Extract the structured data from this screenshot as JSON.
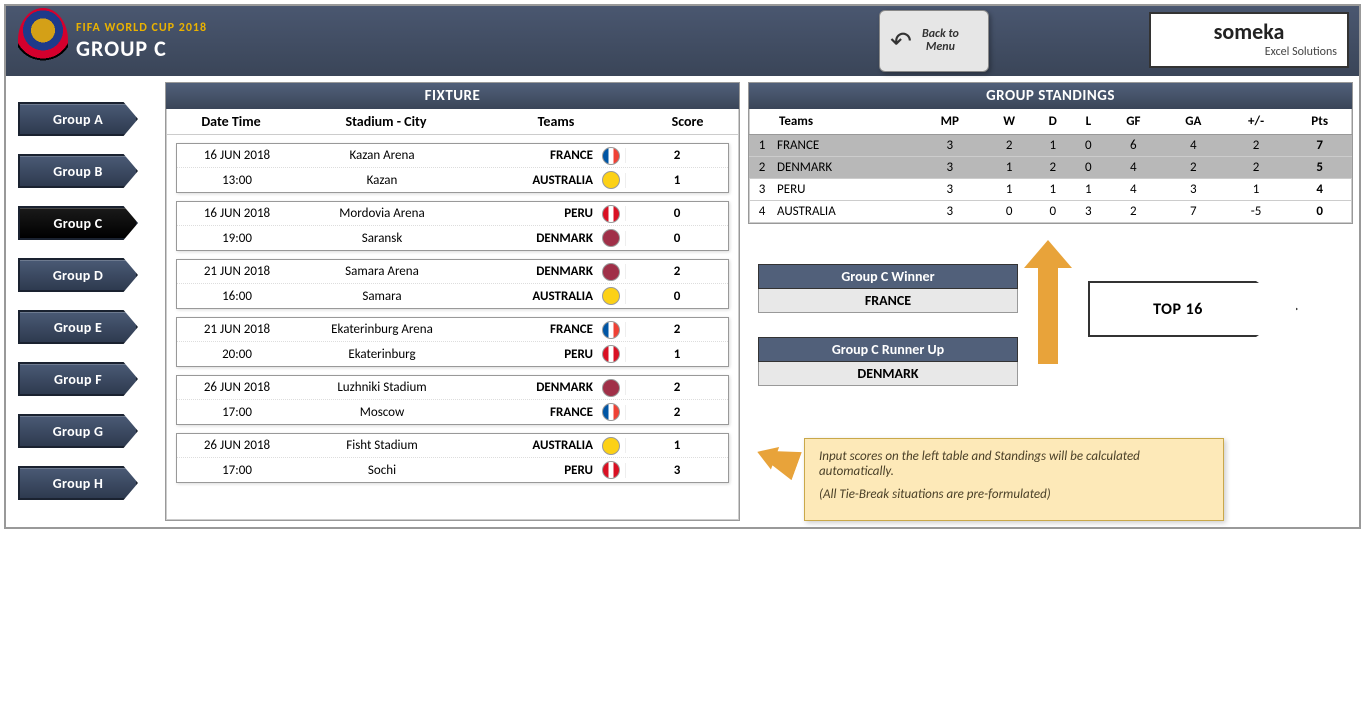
{
  "header": {
    "subtitle": "FIFA WORLD CUP 2018",
    "title": "GROUP C",
    "back_line1": "Back to",
    "back_line2": "Menu",
    "brand": "someka",
    "brand_sub": "Excel Solutions"
  },
  "nav": [
    {
      "label": "Group A",
      "active": false
    },
    {
      "label": "Group B",
      "active": false
    },
    {
      "label": "Group C",
      "active": true
    },
    {
      "label": "Group D",
      "active": false
    },
    {
      "label": "Group E",
      "active": false
    },
    {
      "label": "Group F",
      "active": false
    },
    {
      "label": "Group G",
      "active": false
    },
    {
      "label": "Group H",
      "active": false
    }
  ],
  "fixture": {
    "title": "FIXTURE",
    "cols": {
      "date": "Date Time",
      "stadium": "Stadium - City",
      "teams": "Teams",
      "score": "Score"
    },
    "matches": [
      {
        "date": "16 JUN 2018",
        "time": "13:00",
        "stadium": "Kazan Arena",
        "city": "Kazan",
        "team1": "FRANCE",
        "flag1": "france",
        "score1": "2",
        "team2": "AUSTRALIA",
        "flag2": "australia",
        "score2": "1"
      },
      {
        "date": "16 JUN 2018",
        "time": "19:00",
        "stadium": "Mordovia Arena",
        "city": "Saransk",
        "team1": "PERU",
        "flag1": "peru",
        "score1": "0",
        "team2": "DENMARK",
        "flag2": "denmark",
        "score2": "0"
      },
      {
        "date": "21 JUN 2018",
        "time": "16:00",
        "stadium": "Samara Arena",
        "city": "Samara",
        "team1": "DENMARK",
        "flag1": "denmark",
        "score1": "2",
        "team2": "AUSTRALIA",
        "flag2": "australia",
        "score2": "0"
      },
      {
        "date": "21 JUN 2018",
        "time": "20:00",
        "stadium": "Ekaterinburg Arena",
        "city": "Ekaterinburg",
        "team1": "FRANCE",
        "flag1": "france",
        "score1": "2",
        "team2": "PERU",
        "flag2": "peru",
        "score2": "1"
      },
      {
        "date": "26 JUN 2018",
        "time": "17:00",
        "stadium": "Luzhniki Stadium",
        "city": "Moscow",
        "team1": "DENMARK",
        "flag1": "denmark",
        "score1": "2",
        "team2": "FRANCE",
        "flag2": "france",
        "score2": "2"
      },
      {
        "date": "26 JUN 2018",
        "time": "17:00",
        "stadium": "Fisht Stadium",
        "city": "Sochi",
        "team1": "AUSTRALIA",
        "flag1": "australia",
        "score1": "1",
        "team2": "PERU",
        "flag2": "peru",
        "score2": "3"
      }
    ]
  },
  "standings": {
    "title": "GROUP STANDINGS",
    "cols": {
      "teams": "Teams",
      "mp": "MP",
      "w": "W",
      "d": "D",
      "l": "L",
      "gf": "GF",
      "ga": "GA",
      "diff": "+/-",
      "pts": "Pts"
    },
    "rows": [
      {
        "rank": "1",
        "team": "FRANCE",
        "mp": "3",
        "w": "2",
        "d": "1",
        "l": "0",
        "gf": "6",
        "ga": "4",
        "diff": "2",
        "pts": "7",
        "q": true
      },
      {
        "rank": "2",
        "team": "DENMARK",
        "mp": "3",
        "w": "1",
        "d": "2",
        "l": "0",
        "gf": "4",
        "ga": "2",
        "diff": "2",
        "pts": "5",
        "q": true
      },
      {
        "rank": "3",
        "team": "PERU",
        "mp": "3",
        "w": "1",
        "d": "1",
        "l": "1",
        "gf": "4",
        "ga": "3",
        "diff": "1",
        "pts": "4",
        "q": false
      },
      {
        "rank": "4",
        "team": "AUSTRALIA",
        "mp": "3",
        "w": "0",
        "d": "0",
        "l": "3",
        "gf": "2",
        "ga": "7",
        "diff": "-5",
        "pts": "0",
        "q": false
      }
    ]
  },
  "results": {
    "winner_label": "Group C Winner",
    "winner": "FRANCE",
    "runnerup_label": "Group C Runner Up",
    "runnerup": "DENMARK",
    "top16": "TOP 16"
  },
  "hint": {
    "line1": "Input scores on the left table and Standings will be calculated automatically.",
    "line2": "(All Tie-Break situations are pre-formulated)"
  }
}
